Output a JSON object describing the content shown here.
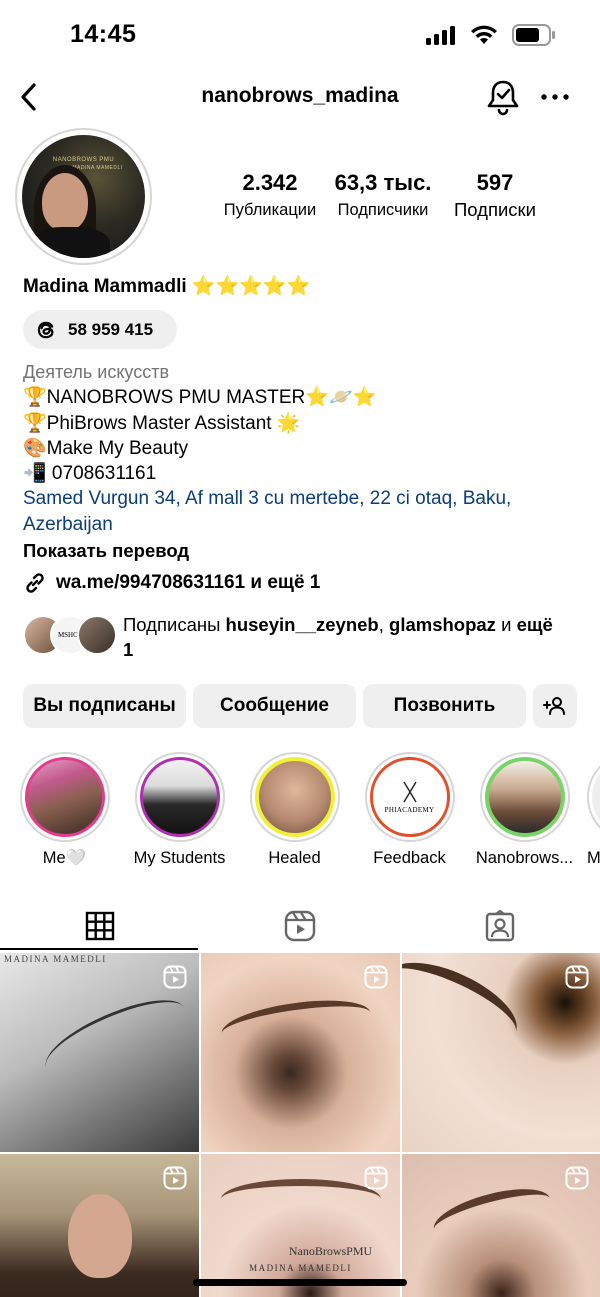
{
  "status_bar": {
    "time": "14:45"
  },
  "nav": {
    "username": "nanobrows_madina"
  },
  "profile": {
    "avatar_brand": "NANOBROWS PMU",
    "avatar_name": "MADINA MAMEDLI"
  },
  "stats": [
    {
      "value": "2.342",
      "label": "Публикации"
    },
    {
      "value": "63,3 тыс.",
      "label": "Подписчики"
    },
    {
      "value": "597",
      "label": "Подписки"
    }
  ],
  "name": "Madina Mammadli ⭐⭐⭐⭐⭐",
  "threads": {
    "count": "58 959 415"
  },
  "bio": {
    "category": "Деятель искусств",
    "lines": [
      "🏆NANOBROWS PMU MASTER⭐🪐⭐",
      "🏆PhiBrows Master Assistant 🌟",
      "🎨Make My Beauty",
      "📲 0708631161"
    ],
    "address": "Samed Vurgun 34, Af mall 3 cu mertebe, 22 ci otaq, Baku, Azerbaijan",
    "translate": "Показать перевод"
  },
  "link": {
    "text": "wa.me/994708631161 и ещё 1"
  },
  "followed_by": {
    "prefix": "Подписаны ",
    "user1": "huseyin__zeyneb",
    "sep": ", ",
    "user2": "glamshopaz",
    "and": " и ",
    "more": "ещё 1"
  },
  "actions": {
    "following": "Вы подписаны",
    "message": "Сообщение",
    "call": "Позвонить"
  },
  "highlights": [
    {
      "label": "Me🤍"
    },
    {
      "label": "My Students"
    },
    {
      "label": "Healed"
    },
    {
      "label": "Feedback"
    },
    {
      "label": "Nanobrows..."
    },
    {
      "label": "M"
    }
  ],
  "feedback_logo_text": "PHIACADEMY",
  "grid": {
    "watermark_1": "MADINA MAMEDLI",
    "watermark_5_brand": "NanoBrowsPMU",
    "watermark_5_name": "MADINA MAMEDLI"
  },
  "colors": {
    "link": "#0c3d7a",
    "secondary_text": "#737373",
    "button_bg": "#efefef"
  }
}
